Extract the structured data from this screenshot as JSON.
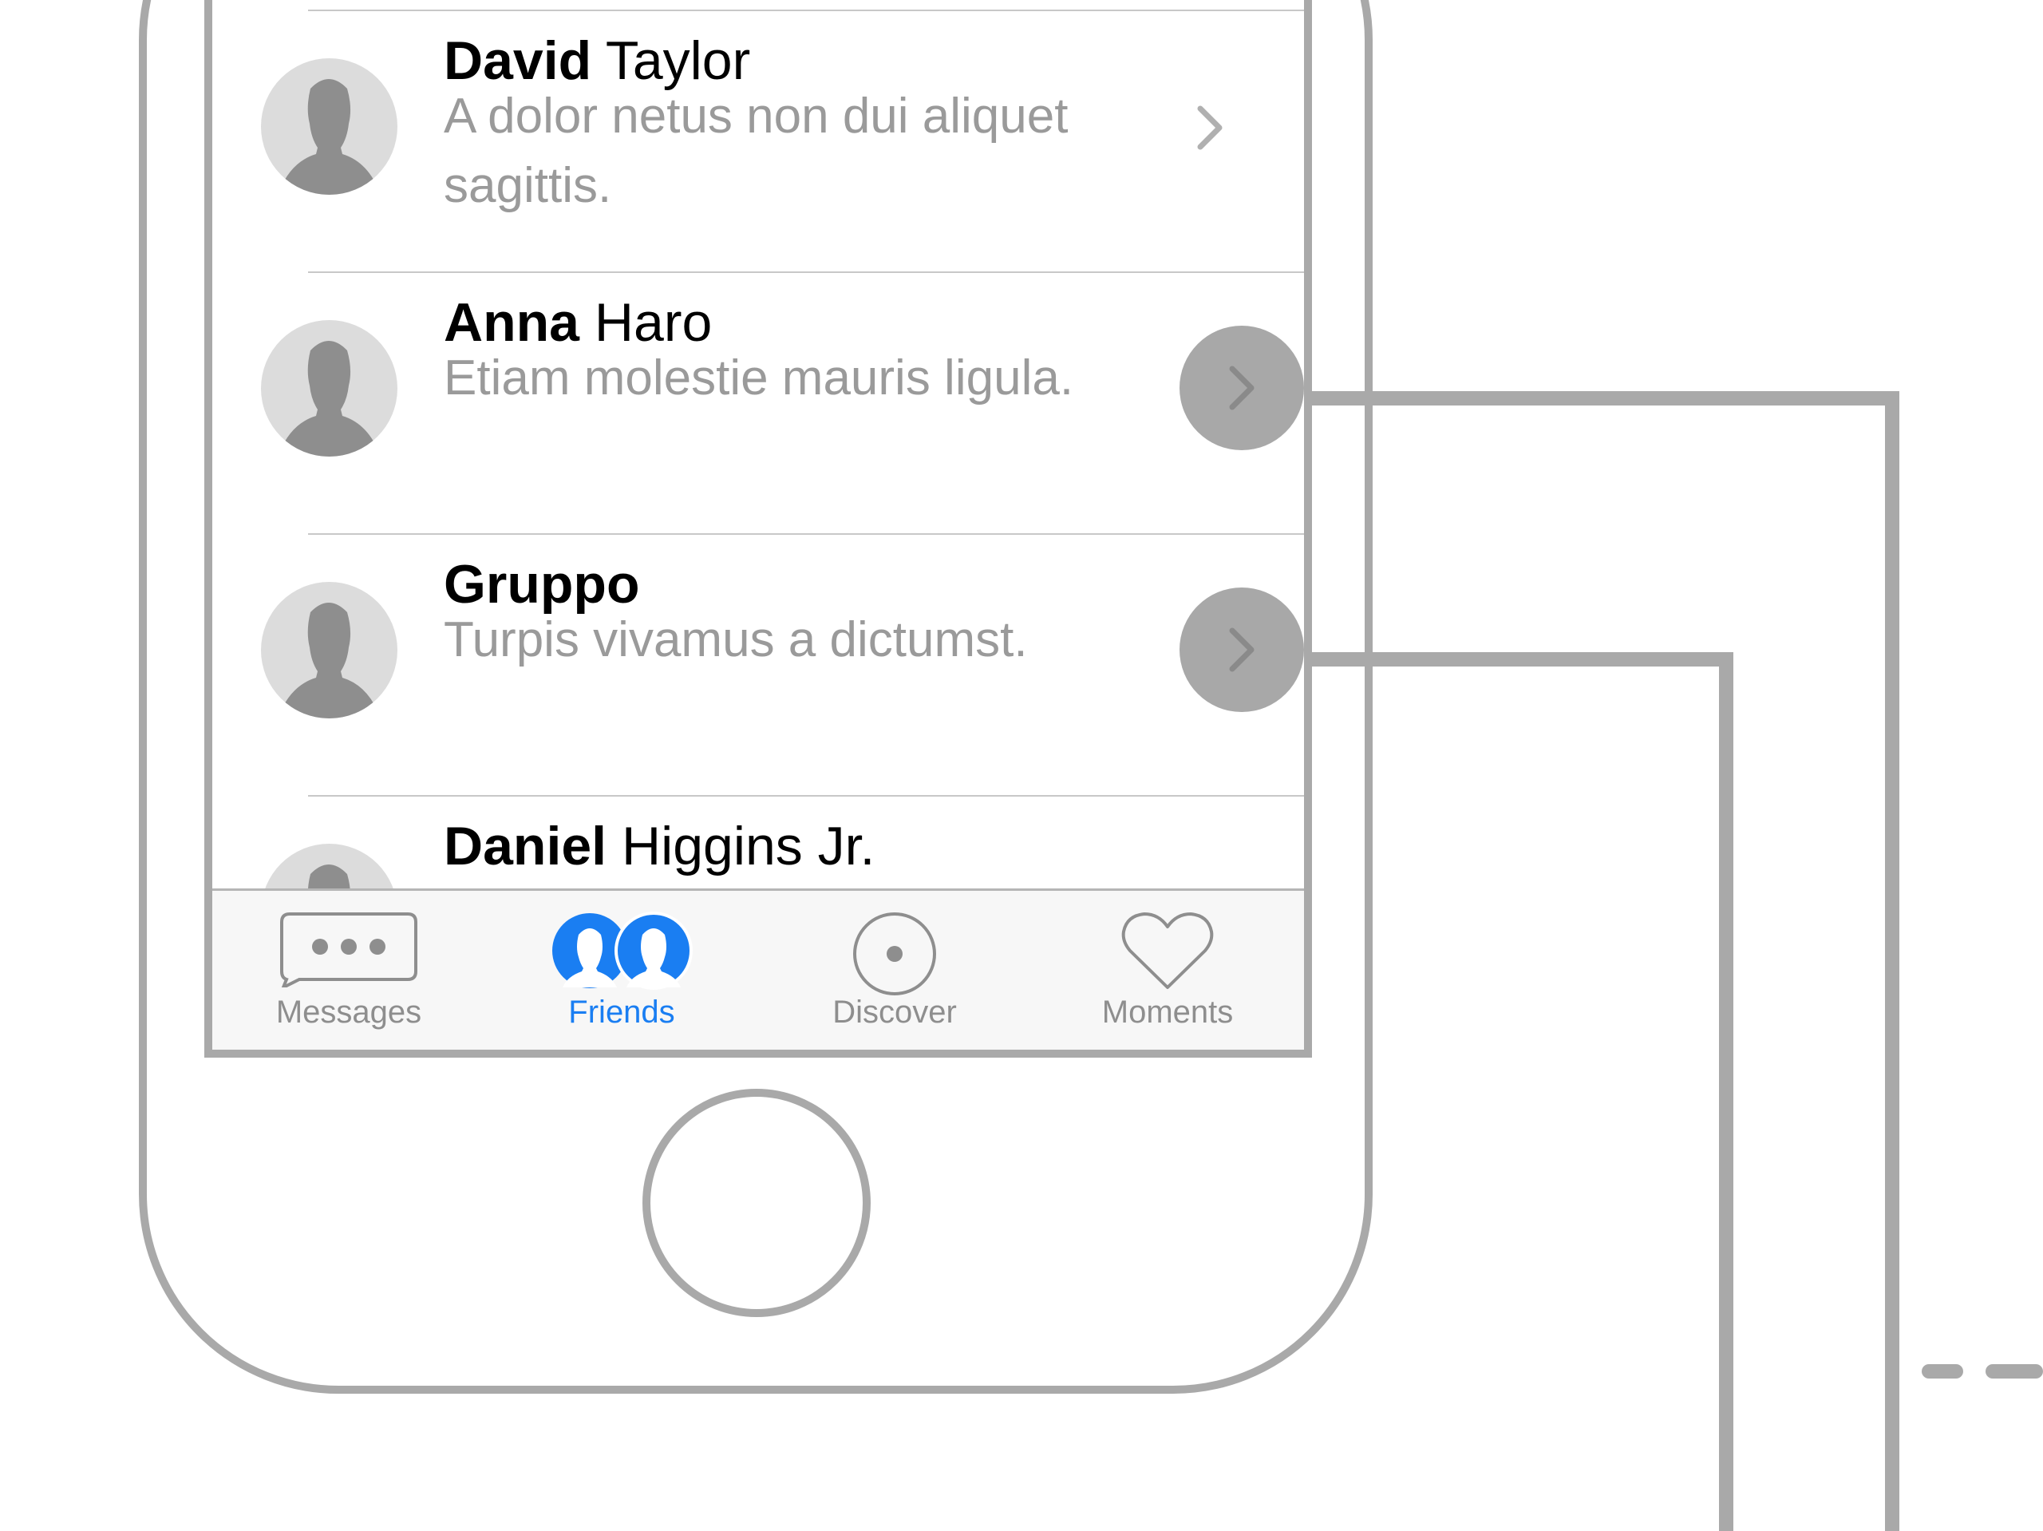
{
  "contacts": [
    {
      "first": "David",
      "last": "Taylor",
      "message": "A dolor netus non dui aliquet sagittis."
    },
    {
      "first": "Anna",
      "last": "Haro",
      "message": "Etiam molestie mauris ligula."
    },
    {
      "first": "Gruppo",
      "last": "",
      "message": "Turpis vivamus a dictumst."
    },
    {
      "first": "Daniel",
      "last": "Higgins Jr.",
      "message": ""
    }
  ],
  "tabbar": {
    "tabs": [
      {
        "label": "Messages",
        "icon": "messages-icon",
        "active": false
      },
      {
        "label": "Friends",
        "icon": "friends-icon",
        "active": true
      },
      {
        "label": "Discover",
        "icon": "discover-icon",
        "active": false
      },
      {
        "label": "Moments",
        "icon": "moments-icon",
        "active": false
      }
    ]
  },
  "colors": {
    "accent": "#1a7ef2",
    "outline": "#a9a9a9",
    "secondary_text": "#9a9a9a",
    "tabbar_bg": "#f7f7f7"
  }
}
